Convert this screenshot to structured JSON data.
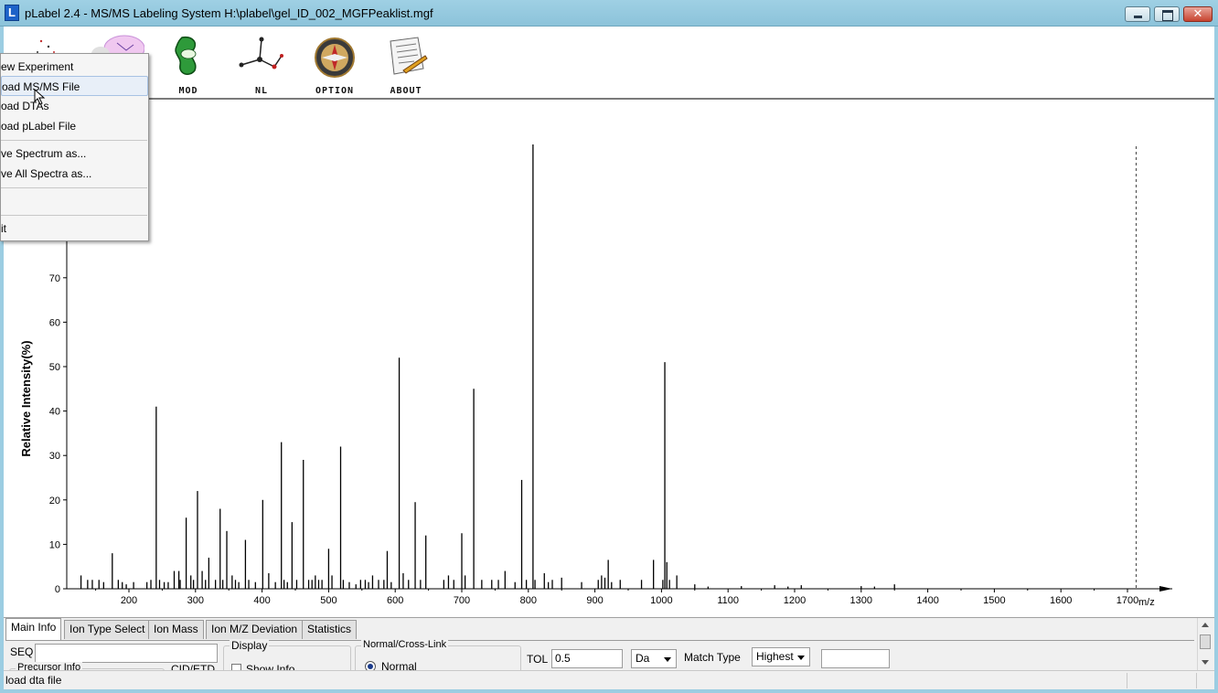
{
  "window": {
    "title": "pLabel 2.4 - MS/MS Labeling System H:\\plabel\\gel_ID_002_MGFPeaklist.mgf",
    "app_icon_letter": "L"
  },
  "toolbar": {
    "buttons": [
      {
        "label": "",
        "icon": "scatter-icon"
      },
      {
        "label": "",
        "icon": "cloud-icon"
      },
      {
        "label": "MOD",
        "icon": "protein-icon"
      },
      {
        "label": "NL",
        "icon": "molecule-icon"
      },
      {
        "label": "OPTION",
        "icon": "compass-icon"
      },
      {
        "label": "ABOUT",
        "icon": "document-pen-icon"
      }
    ]
  },
  "file_menu": {
    "items": [
      "ew Experiment",
      "oad MS/MS File",
      "oad DTAs",
      "oad pLabel File",
      "ve Spectrum as...",
      "ve All Spectra as...",
      "",
      "it"
    ]
  },
  "chart_data": {
    "type": "bar",
    "ylabel": "Relative   Intensity(%)",
    "xlabel": "m/z",
    "xlim": [
      100,
      1700
    ],
    "ylim": [
      0,
      100
    ],
    "x_ticks": [
      200,
      300,
      400,
      500,
      600,
      700,
      800,
      900,
      1000,
      1100,
      1200,
      1300,
      1400,
      1500,
      1600,
      1700
    ],
    "y_ticks": [
      0,
      10,
      20,
      30,
      40,
      50,
      60,
      70
    ],
    "y_tick_labels": [
      "0",
      "10",
      "20",
      "30",
      "40",
      "50",
      "60",
      "70"
    ],
    "x_tick_labels": [
      "200",
      "300",
      "400",
      "500",
      "600",
      "700",
      "800",
      "900",
      "1000",
      "1100",
      "1200",
      "1300",
      "1400",
      "1500",
      "1600",
      "1700"
    ],
    "cutoff_mz": 1713,
    "peaks": [
      [
        128,
        3
      ],
      [
        138,
        2
      ],
      [
        145,
        2
      ],
      [
        155,
        2
      ],
      [
        162,
        1.5
      ],
      [
        175,
        8
      ],
      [
        184,
        2
      ],
      [
        190,
        1.5
      ],
      [
        196,
        1
      ],
      [
        207,
        1.5
      ],
      [
        227,
        1.5
      ],
      [
        233,
        2
      ],
      [
        241,
        41
      ],
      [
        246,
        2
      ],
      [
        253,
        1.5
      ],
      [
        259,
        1.5
      ],
      [
        268,
        4
      ],
      [
        275,
        4
      ],
      [
        277,
        2
      ],
      [
        286,
        16
      ],
      [
        293,
        3
      ],
      [
        297,
        2
      ],
      [
        303,
        22
      ],
      [
        310,
        4
      ],
      [
        315,
        2
      ],
      [
        320,
        7
      ],
      [
        330,
        2
      ],
      [
        337,
        18
      ],
      [
        341,
        2
      ],
      [
        347,
        13
      ],
      [
        355,
        3
      ],
      [
        360,
        2
      ],
      [
        365,
        1.5
      ],
      [
        375,
        11
      ],
      [
        380,
        2
      ],
      [
        390,
        1.5
      ],
      [
        401,
        20
      ],
      [
        410,
        3.5
      ],
      [
        420,
        1.5
      ],
      [
        429,
        33
      ],
      [
        433,
        2
      ],
      [
        438,
        1.5
      ],
      [
        445,
        15
      ],
      [
        452,
        2
      ],
      [
        462,
        29
      ],
      [
        470,
        2
      ],
      [
        475,
        2
      ],
      [
        480,
        3
      ],
      [
        485,
        2
      ],
      [
        490,
        2
      ],
      [
        500,
        9
      ],
      [
        505,
        3
      ],
      [
        518,
        32
      ],
      [
        522,
        2
      ],
      [
        531,
        1.5
      ],
      [
        541,
        1
      ],
      [
        548,
        2
      ],
      [
        555,
        2
      ],
      [
        560,
        1.5
      ],
      [
        566,
        3
      ],
      [
        575,
        2
      ],
      [
        583,
        2
      ],
      [
        588,
        8.5
      ],
      [
        594,
        1.5
      ],
      [
        606,
        52
      ],
      [
        612,
        3.5
      ],
      [
        620,
        2
      ],
      [
        630,
        19.5
      ],
      [
        638,
        2
      ],
      [
        646,
        12
      ],
      [
        673,
        2
      ],
      [
        680,
        3
      ],
      [
        688,
        2
      ],
      [
        700,
        12.5
      ],
      [
        705,
        3
      ],
      [
        718,
        45
      ],
      [
        730,
        2
      ],
      [
        745,
        2
      ],
      [
        755,
        2
      ],
      [
        765,
        4
      ],
      [
        780,
        1.5
      ],
      [
        790,
        24.5
      ],
      [
        797,
        2
      ],
      [
        807,
        100
      ],
      [
        810,
        2
      ],
      [
        824,
        3.5
      ],
      [
        830,
        1.5
      ],
      [
        836,
        2
      ],
      [
        850,
        2.5
      ],
      [
        880,
        1.5
      ],
      [
        905,
        2
      ],
      [
        910,
        3
      ],
      [
        915,
        2.5
      ],
      [
        920,
        6.5
      ],
      [
        925,
        1.5
      ],
      [
        938,
        2
      ],
      [
        970,
        2
      ],
      [
        988,
        6.5
      ],
      [
        1002,
        2
      ],
      [
        1005,
        51
      ],
      [
        1008,
        6
      ],
      [
        1012,
        2
      ],
      [
        1023,
        3
      ],
      [
        1050,
        1
      ],
      [
        1070,
        0.5
      ],
      [
        1120,
        0.6
      ],
      [
        1170,
        0.8
      ],
      [
        1190,
        0.5
      ],
      [
        1210,
        0.8
      ],
      [
        1300,
        0.6
      ],
      [
        1320,
        0.5
      ],
      [
        1350,
        1
      ]
    ]
  },
  "bottom_panel": {
    "tabs": [
      "Main Info",
      "Ion Type Select",
      "Ion Mass",
      "Ion M/Z Deviation",
      "Statistics"
    ],
    "active_tab": "Main Info",
    "seq_label": "SEQ",
    "seq_value": "",
    "precursor_label": "Precursor Info",
    "cid_label": "CID/ETD",
    "display_group": "Display",
    "show_info_label": "Show Info",
    "normal_group": "Normal/Cross-Link",
    "normal_label": "Normal",
    "tol_label": "TOL",
    "tol_value": "0.5",
    "tol_unit": "Da",
    "match_type_label": "Match Type",
    "match_type_value": "Highest",
    "extra_value": ""
  },
  "status": {
    "text": "load dta file"
  }
}
